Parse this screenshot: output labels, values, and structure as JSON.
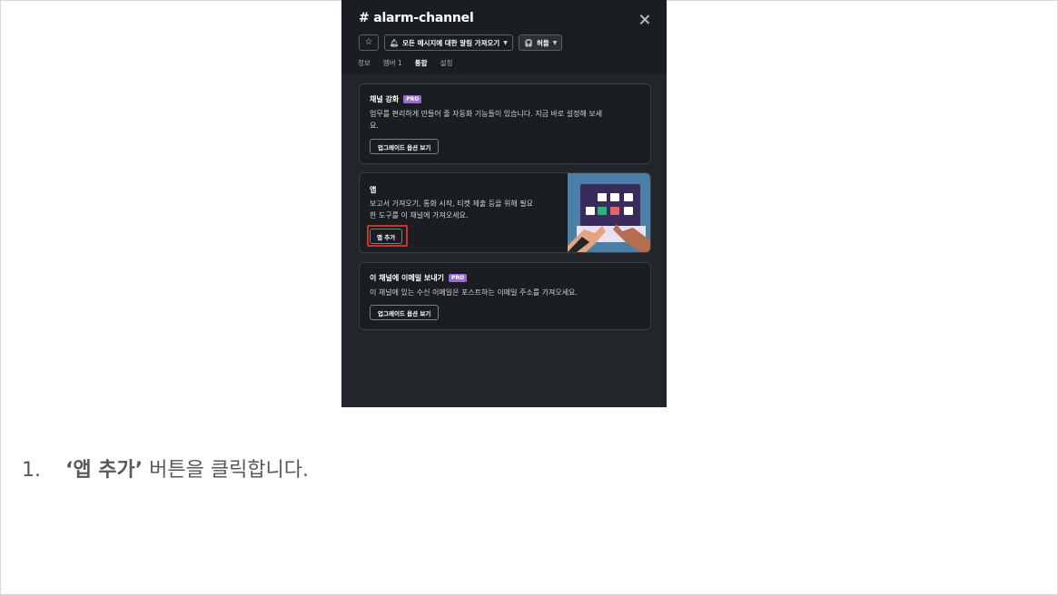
{
  "panel": {
    "title": "# alarm-channel",
    "toolbar": {
      "notify_label": "모든 메시지에 대한 알림 가져오기",
      "huddle_label": "허들"
    },
    "tabs": [
      {
        "label": "정보",
        "active": false
      },
      {
        "label": "멤버 1",
        "active": false
      },
      {
        "label": "통합",
        "active": true
      },
      {
        "label": "설정",
        "active": false
      }
    ],
    "cards": {
      "enhance": {
        "title": "채널 강화",
        "badge": "PRO",
        "desc_line1": "업무를 편리하게 만들어 줄 자동화 기능들이 있습니다. 지금 바로 설정해 보세",
        "desc_line2": "요.",
        "button": "업그레이드 옵션 보기"
      },
      "apps": {
        "title": "앱",
        "desc_line1": "보고서 가져오기, 통화 시작, 티켓 제출 등을 위해 필요",
        "desc_line2": "한 도구를 이 채널에 가져오세요.",
        "button": "앱 추가"
      },
      "email": {
        "title": "이 채널에 이메일 보내기",
        "badge": "PRO",
        "desc_line1": "이 채널에 있는 수신 이메일은 포스트하는 이메일 주소를 가져오세요.",
        "button": "업그레이드 옵션 보기"
      }
    }
  },
  "caption": {
    "number": "1.",
    "bold_text": "‘앱 추가’",
    "rest_text": "버튼을 클릭합니다."
  },
  "colors": {
    "panel_bg": "#1a1d21",
    "body_bg": "#222529",
    "pro_badge": "#9b6bd1",
    "highlight": "#d0312d",
    "illustration_bg": "#4a7fa8"
  },
  "icons": [
    "star-icon",
    "bell-icon",
    "headphones-icon",
    "chevron-down-icon",
    "close-icon"
  ]
}
